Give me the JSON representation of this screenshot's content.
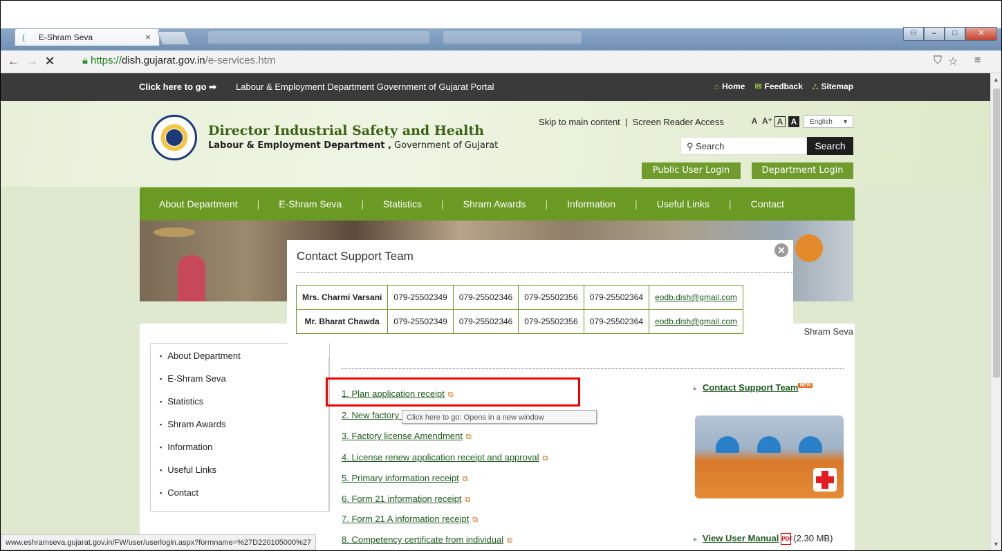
{
  "browser": {
    "tab_title": "E-Shram Seva",
    "tab_close": "×",
    "url_protocol": "https://",
    "url_host": "dish.gujarat.gov.in",
    "url_path": "/e-services.htm"
  },
  "topstrip": {
    "go_label": "Click here to go",
    "go_link": "Labour & Employment Department Government of Gujarat Portal",
    "home": "Home",
    "feedback": "Feedback",
    "sitemap": "Sitemap"
  },
  "header": {
    "org_name": "Director Industrial Safety and Health",
    "dept_bold": "Labour & Employment Department ,",
    "dept_rest": " Government of Gujarat",
    "skip_links": "Skip to main content  |  Screen Reader Access",
    "font_small": "A",
    "font_large": "A⁺",
    "font_box": "A",
    "font_dark": "A",
    "language": "English",
    "search_placeholder": "Search",
    "search_button": "Search",
    "public_login": "Public User Login",
    "department_login": "Department Login"
  },
  "main_nav": [
    "About Department",
    "E-Shram Seva",
    "Statistics",
    "Shram Awards",
    "Information",
    "Useful Links",
    "Contact"
  ],
  "breadcrumb": "Shram Seva",
  "sidebar": [
    "About Department",
    "E-Shram Seva",
    "Statistics",
    "Shram Awards",
    "Information",
    "Useful Links",
    "Contact"
  ],
  "services": [
    "1. Plan application receipt",
    "2. New factory License application",
    "3. Factory license Amendment",
    "4. License renew application receipt and approval",
    "5. Primary information receipt",
    "6. Form 21 information receipt",
    "7. Form 21 A information receipt",
    "8. Competency certificate from individual"
  ],
  "tooltip": "Click here to go: Opens in a new window",
  "right_links": {
    "contact_support": "Contact Support Team",
    "new_badge": "NEW",
    "user_manual": "View User Manual",
    "manual_size": "(2.30 MB)"
  },
  "modal": {
    "title": "Contact Support Team",
    "close": "✕",
    "contacts": [
      {
        "name": "Mrs. Charmi Varsani",
        "p1": "079-25502349",
        "p2": "079-25502346",
        "p3": "079-25502356",
        "p4": "079-25502364",
        "email": "eodb.dish@gmail.com"
      },
      {
        "name": "Mr. Bharat Chawda",
        "p1": "079-25502349",
        "p2": "079-25502346",
        "p3": "079-25502356",
        "p4": "079-25502364",
        "email": "eodb.dish@gmail.com"
      }
    ]
  },
  "status_bar": "www.eshramseva.gujarat.gov.in/FW/user/userlogin.aspx?formname=%27D220105000%27",
  "colors": {
    "nav_green": "#6b9a24",
    "topstrip": "#3a3a3a",
    "highlight_red": "#e00000"
  }
}
